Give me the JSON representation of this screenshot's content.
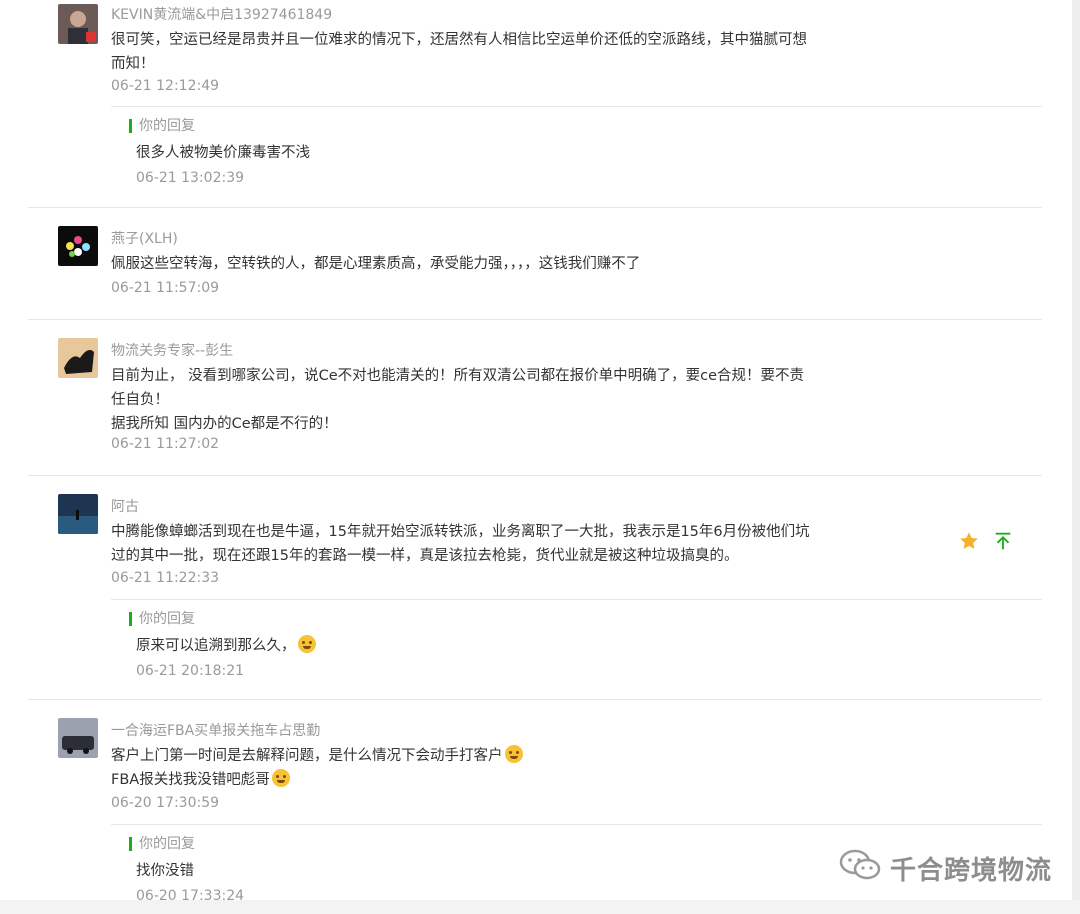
{
  "comments": [
    {
      "nickname": "KEVIN黄流端&中启13927461849",
      "content": "很可笑，空运已经是昂贵并且一位难求的情况下，还居然有人相信比空运单价还低的空派路线，其中猫腻可想而知！",
      "time": "06-21 12:12:49",
      "reply": {
        "label": "你的回复",
        "text": "很多人被物美价廉毒害不浅",
        "time": "06-21 13:02:39"
      }
    },
    {
      "nickname": "燕子(XLH)",
      "content": "佩服这些空转海，空转铁的人，都是心理素质高，承受能力强，，，，这钱我们赚不了",
      "time": "06-21 11:57:09"
    },
    {
      "nickname": "物流关务专家--彭生",
      "content": "目前为止， 没看到哪家公司，说Ce不对也能清关的！所有双清公司都在报价单中明确了，要ce合规！要不责任自负！\n据我所知 国内办的Ce都是不行的！",
      "time": "06-21 11:27:02"
    },
    {
      "nickname": "阿古",
      "content": "中腾能像蟑螂活到现在也是牛逼，15年就开始空派转铁派，业务离职了一大批，我表示是15年6月份被他们坑过的其中一批，现在还跟15年的套路一模一样，真是该拉去枪毙，货代业就是被这种垃圾搞臭的。",
      "time": "06-21 11:22:33",
      "reply": {
        "label": "你的回复",
        "text": "原来可以追溯到那么久，",
        "time": "06-21 20:18:21"
      }
    },
    {
      "nickname": "一合海运FBA买单报关拖车占思勤",
      "content_line1": "客户上门第一时间是去解释问题，是什么情况下会动手打客户",
      "content_line2": "FBA报关找我没错吧彪哥",
      "time": "06-20 17:30:59",
      "reply": {
        "label": "你的回复",
        "text": "找你没错",
        "time": "06-20 17:33:24"
      }
    }
  ],
  "watermark": {
    "text": "千合跨境物流",
    "icon": "wechat-icon"
  },
  "actions": {
    "star_icon": "star-icon",
    "top_icon": "pin-top-icon",
    "star_color": "#f6b12a",
    "top_color": "#1aad19"
  }
}
